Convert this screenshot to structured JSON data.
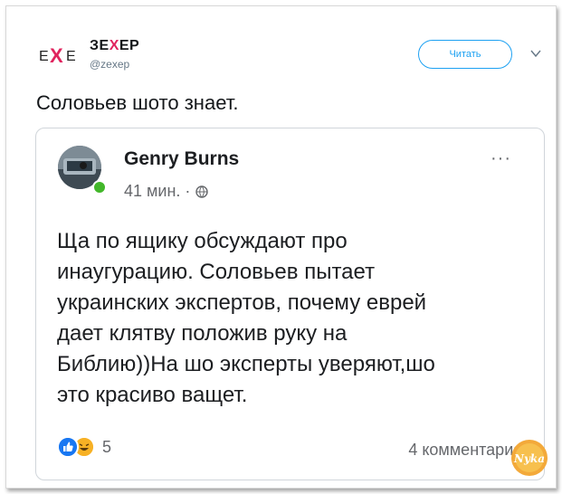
{
  "tweet": {
    "author_name_pre": "ЗЕ",
    "author_name_x": "Х",
    "author_name_post": "ЕР",
    "author_handle": "@zexep",
    "logo_left": "Е",
    "logo_x": "Х",
    "logo_right": "Е",
    "follow_label": "Читать",
    "text": "Соловьев шото знает."
  },
  "post": {
    "author": "Genry Burns",
    "time": "41 мин. ·",
    "more": "···",
    "body": "Ща по ящику обсуждают про\nинаугурацию. Соловьев пытает\nукраинских экспертов, почему еврей\nдает клятву положив руку на\nБиблию))На шо эксперты уверяют,шо\nэто красиво ващет.",
    "reaction_count": "5",
    "comments": "4 комментария",
    "watermark": "Nyka"
  },
  "colors": {
    "accent": "#1da1f2",
    "brand_x": "#e0245e",
    "like": "#1877f2",
    "online": "#42b72a"
  }
}
